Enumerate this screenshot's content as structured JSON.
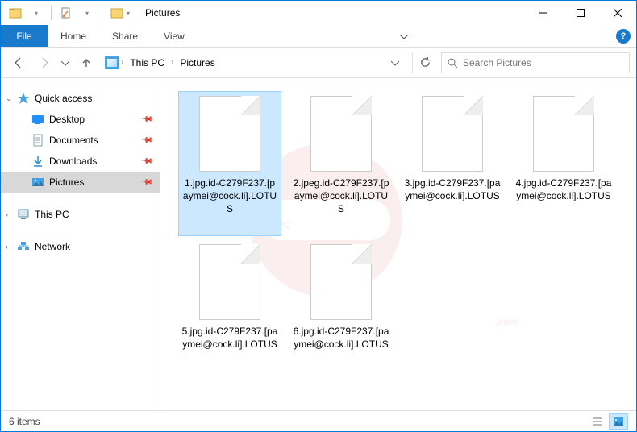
{
  "window": {
    "title": "Pictures"
  },
  "ribbon": {
    "file": "File",
    "tabs": [
      "Home",
      "Share",
      "View"
    ]
  },
  "breadcrumb": {
    "parts": [
      "This PC",
      "Pictures"
    ]
  },
  "search": {
    "placeholder": "Search Pictures"
  },
  "sidebar": {
    "quick_access": "Quick access",
    "items": [
      {
        "label": "Desktop",
        "pinned": true
      },
      {
        "label": "Documents",
        "pinned": true
      },
      {
        "label": "Downloads",
        "pinned": true
      },
      {
        "label": "Pictures",
        "pinned": true,
        "selected": true
      }
    ],
    "this_pc": "This PC",
    "network": "Network"
  },
  "files": [
    {
      "name": "1.jpg.id-C279F237.[paymei@cock.li].LOTUS",
      "selected": true
    },
    {
      "name": "2.jpeg.id-C279F237.[paymei@cock.li].LOTUS"
    },
    {
      "name": "3.jpg.id-C279F237.[paymei@cock.li].LOTUS"
    },
    {
      "name": "4.jpg.id-C279F237.[paymei@cock.li].LOTUS"
    },
    {
      "name": "5.jpg.id-C279F237.[paymei@cock.li].LOTUS"
    },
    {
      "name": "6.jpg.id-C279F237.[paymei@cock.li].LOTUS"
    }
  ],
  "status": {
    "count_label": "6 items"
  }
}
